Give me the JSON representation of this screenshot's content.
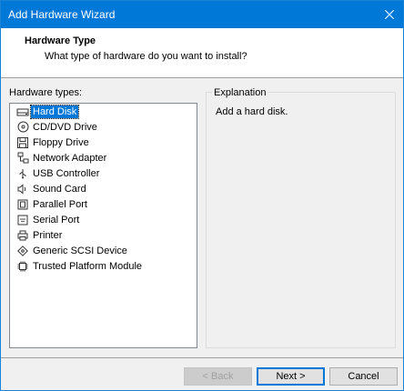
{
  "window": {
    "title": "Add Hardware Wizard",
    "close_icon": "close-icon"
  },
  "header": {
    "title": "Hardware Type",
    "subtitle": "What type of hardware do you want to install?"
  },
  "hardware_list": {
    "label": "Hardware types:",
    "items": [
      {
        "label": "Hard Disk",
        "icon": "hard-disk-icon"
      },
      {
        "label": "CD/DVD Drive",
        "icon": "cd-dvd-icon"
      },
      {
        "label": "Floppy Drive",
        "icon": "floppy-icon"
      },
      {
        "label": "Network Adapter",
        "icon": "network-icon"
      },
      {
        "label": "USB Controller",
        "icon": "usb-icon"
      },
      {
        "label": "Sound Card",
        "icon": "speaker-icon"
      },
      {
        "label": "Parallel Port",
        "icon": "parallel-port-icon"
      },
      {
        "label": "Serial Port",
        "icon": "serial-port-icon"
      },
      {
        "label": "Printer",
        "icon": "printer-icon"
      },
      {
        "label": "Generic SCSI Device",
        "icon": "scsi-icon"
      },
      {
        "label": "Trusted Platform Module",
        "icon": "tpm-icon"
      }
    ],
    "selected_index": 0
  },
  "explanation": {
    "legend": "Explanation",
    "text": "Add a hard disk."
  },
  "buttons": {
    "back": "< Back",
    "next": "Next >",
    "cancel": "Cancel"
  },
  "colors": {
    "accent": "#0078d7",
    "background": "#f0f0f0"
  }
}
